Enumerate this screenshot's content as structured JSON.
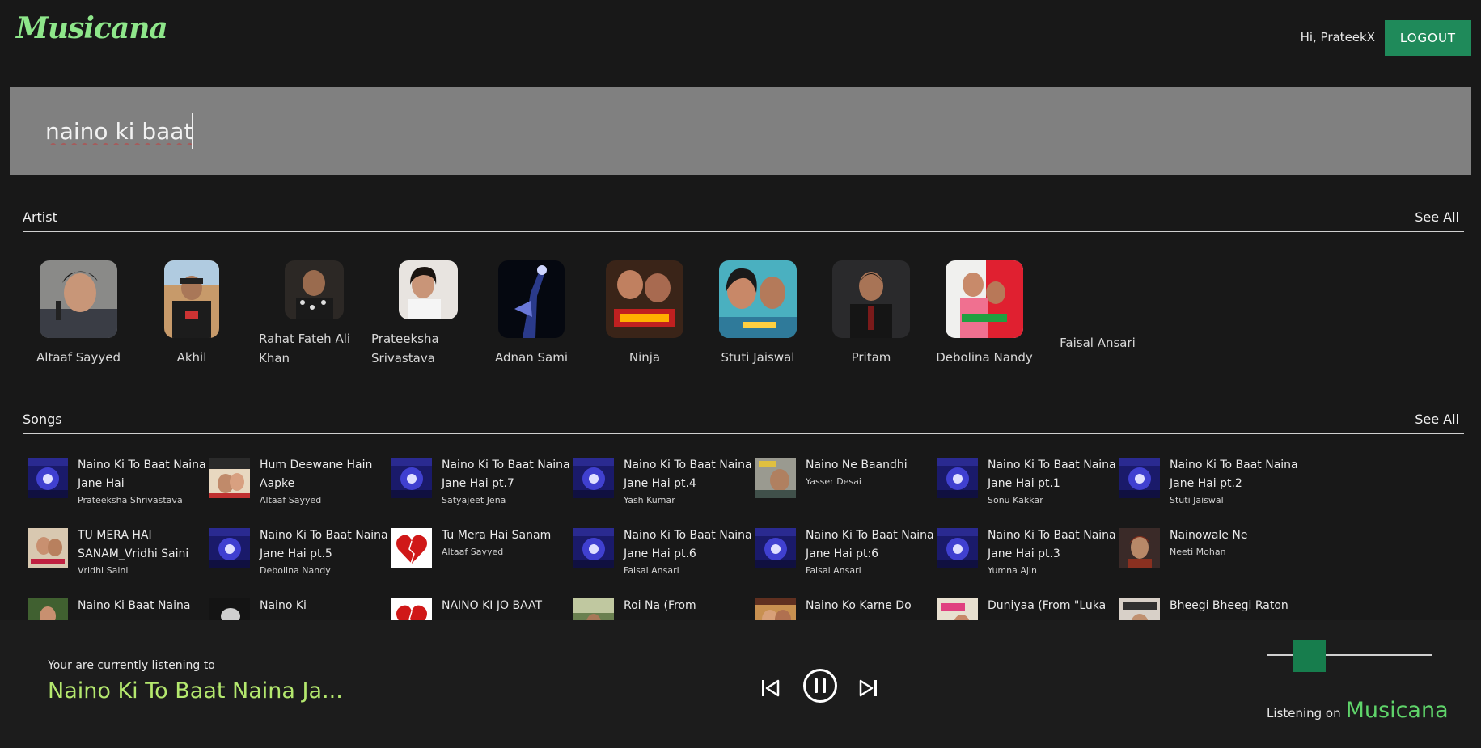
{
  "header": {
    "logo": "Musicana",
    "greeting": "Hi, PrateekX",
    "logout_label": "LOGOUT"
  },
  "search": {
    "value": "naino ki baat"
  },
  "artist_section": {
    "title": "Artist",
    "see_all": "See All",
    "items": [
      {
        "name": "Altaaf Sayyed"
      },
      {
        "name": "Akhil"
      },
      {
        "name": "Rahat Fateh Ali Khan"
      },
      {
        "name": "Prateeksha Srivastava"
      },
      {
        "name": "Adnan Sami"
      },
      {
        "name": "Ninja"
      },
      {
        "name": "Stuti Jaiswal"
      },
      {
        "name": "Pritam"
      },
      {
        "name": "Debolina Nandy"
      },
      {
        "name": "Faisal Ansari"
      }
    ]
  },
  "songs_section": {
    "title": "Songs",
    "see_all": "See All",
    "rows": [
      [
        {
          "title": "Naino Ki To Baat Naina Jane Hai",
          "artist": "Prateeksha Shrivastava",
          "thumb": "concert"
        },
        {
          "title": "Hum Deewane Hain Aapke",
          "artist": "Altaaf Sayyed",
          "thumb": "poster"
        },
        {
          "title": "Naino Ki To Baat Naina Jane Hai pt.7",
          "artist": "Satyajeet Jena",
          "thumb": "concert"
        },
        {
          "title": "Naino Ki To Baat Naina Jane Hai pt.4",
          "artist": "Yash Kumar",
          "thumb": "concert"
        },
        {
          "title": "Naino Ne Baandhi",
          "artist": "Yasser Desai",
          "thumb": "gold"
        },
        {
          "title": "Naino Ki To Baat Naina Jane Hai pt.1",
          "artist": "Sonu Kakkar",
          "thumb": "concert"
        },
        {
          "title": "Naino Ki To Baat Naina Jane Hai pt.2",
          "artist": "Stuti Jaiswal",
          "thumb": "concert"
        }
      ],
      [
        {
          "title": "TU MERA HAI SANAM_Vridhi Saini",
          "artist": "Vridhi Saini",
          "thumb": "poster2"
        },
        {
          "title": "Naino Ki To Baat Naina Jane Hai pt.5",
          "artist": "Debolina Nandy",
          "thumb": "concert"
        },
        {
          "title": "Tu Mera Hai Sanam",
          "artist": "Altaaf Sayyed",
          "thumb": "heart"
        },
        {
          "title": "Naino Ki To Baat Naina Jane Hai pt.6",
          "artist": "Faisal Ansari",
          "thumb": "concert"
        },
        {
          "title": "Naino Ki To Baat Naina Jane Hai pt:6",
          "artist": "Faisal Ansari",
          "thumb": "concert"
        },
        {
          "title": "Naino Ki To Baat Naina Jane Hai pt.3",
          "artist": "Yumna Ajin",
          "thumb": "concert"
        },
        {
          "title": "Nainowale Ne",
          "artist": "Neeti Mohan",
          "thumb": "portrait"
        }
      ],
      [
        {
          "title": "Naino Ki Baat Naina",
          "artist": "",
          "thumb": "poster3"
        },
        {
          "title": "Naino Ki",
          "artist": "",
          "thumb": "dark"
        },
        {
          "title": "NAINO KI JO BAAT",
          "artist": "",
          "thumb": "heart"
        },
        {
          "title": "Roi Na (From",
          "artist": "",
          "thumb": "outdoor"
        },
        {
          "title": "Naino Ko Karne Do",
          "artist": "",
          "thumb": "poster4"
        },
        {
          "title": "Duniyaa (From \"Luka",
          "artist": "",
          "thumb": "poster5"
        },
        {
          "title": "Bheegi Bheegi Raton",
          "artist": "",
          "thumb": "poster6"
        }
      ]
    ]
  },
  "player": {
    "label": "Your are currently listening to",
    "title": "Naino Ki To Baat Naina Ja...",
    "volume": 0.2,
    "listening_prefix": "Listening on",
    "listening_brand": "Musicana"
  },
  "colors": {
    "accent": "#1f8a5a",
    "logo": "#8ee68a",
    "now_playing": "#b4e86e",
    "brand": "#5fd46a"
  }
}
